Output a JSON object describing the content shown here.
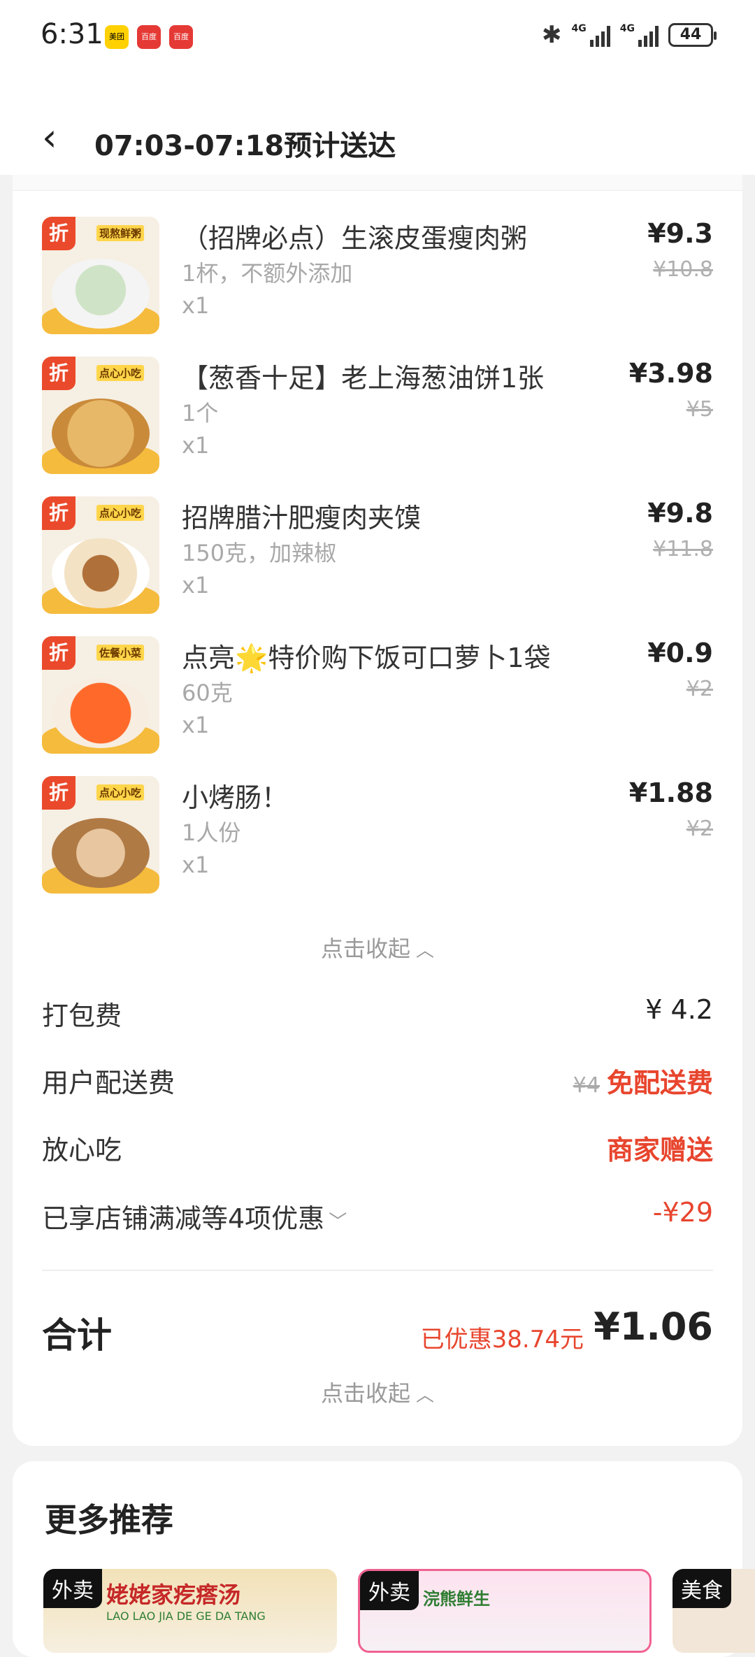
{
  "status_bar": {
    "time": "6:31",
    "apps": [
      "美团",
      "百度",
      "百度"
    ],
    "network1": "4G",
    "network2": "4G",
    "battery": "44"
  },
  "header": {
    "title": "07:03-07:18预计送达"
  },
  "items": [
    {
      "tag": "折",
      "category": "现熬鲜粥",
      "name": "（招牌必点）生滚皮蛋瘦肉粥",
      "spec": "1杯，不额外添加",
      "qty": "x1",
      "price": "¥9.3",
      "old_price": "¥10.8"
    },
    {
      "tag": "折",
      "category": "点心小吃",
      "name": "【葱香十足】老上海葱油饼1张",
      "spec": "1个",
      "qty": "x1",
      "price": "¥3.98",
      "old_price": "¥5"
    },
    {
      "tag": "折",
      "category": "点心小吃",
      "name": "招牌腊汁肥瘦肉夹馍",
      "spec": "150克，加辣椒",
      "qty": "x1",
      "price": "¥9.8",
      "old_price": "¥11.8"
    },
    {
      "tag": "折",
      "category": "佐餐小菜",
      "name": "点亮🌟特价购下饭可口萝卜1袋",
      "spec": "60克",
      "qty": "x1",
      "price": "¥0.9",
      "old_price": "¥2"
    },
    {
      "tag": "折",
      "category": "点心小吃",
      "name": "小烤肠！",
      "spec": "1人份",
      "qty": "x1",
      "price": "¥1.88",
      "old_price": "¥2"
    }
  ],
  "collapse_label": "点击收起",
  "fees": {
    "packing_label": "打包费",
    "packing_value": "¥ 4.2",
    "delivery_label": "用户配送费",
    "delivery_old": "¥4",
    "delivery_value": "免配送费",
    "safe_label": "放心吃",
    "safe_value": "商家赠送",
    "discount_label": "已享店铺满减等4项优惠",
    "discount_value": "-¥29"
  },
  "total": {
    "label": "合计",
    "saved": "已优惠38.74元",
    "value": "¥1.06"
  },
  "recommend": {
    "title": "更多推荐",
    "tiles": [
      {
        "badge": "外卖",
        "text": "姥姥家疙瘩汤",
        "sub": "LAO LAO JIA DE GE DA TANG"
      },
      {
        "badge": "外卖",
        "text": "浣熊鲜生",
        "sub": ""
      },
      {
        "badge": "美食",
        "text": "",
        "sub": ""
      }
    ]
  },
  "colors": {
    "accent_red": "#e8452e",
    "tag_orange": "#ea4a2b",
    "muted_text": "#a8a8a8"
  }
}
